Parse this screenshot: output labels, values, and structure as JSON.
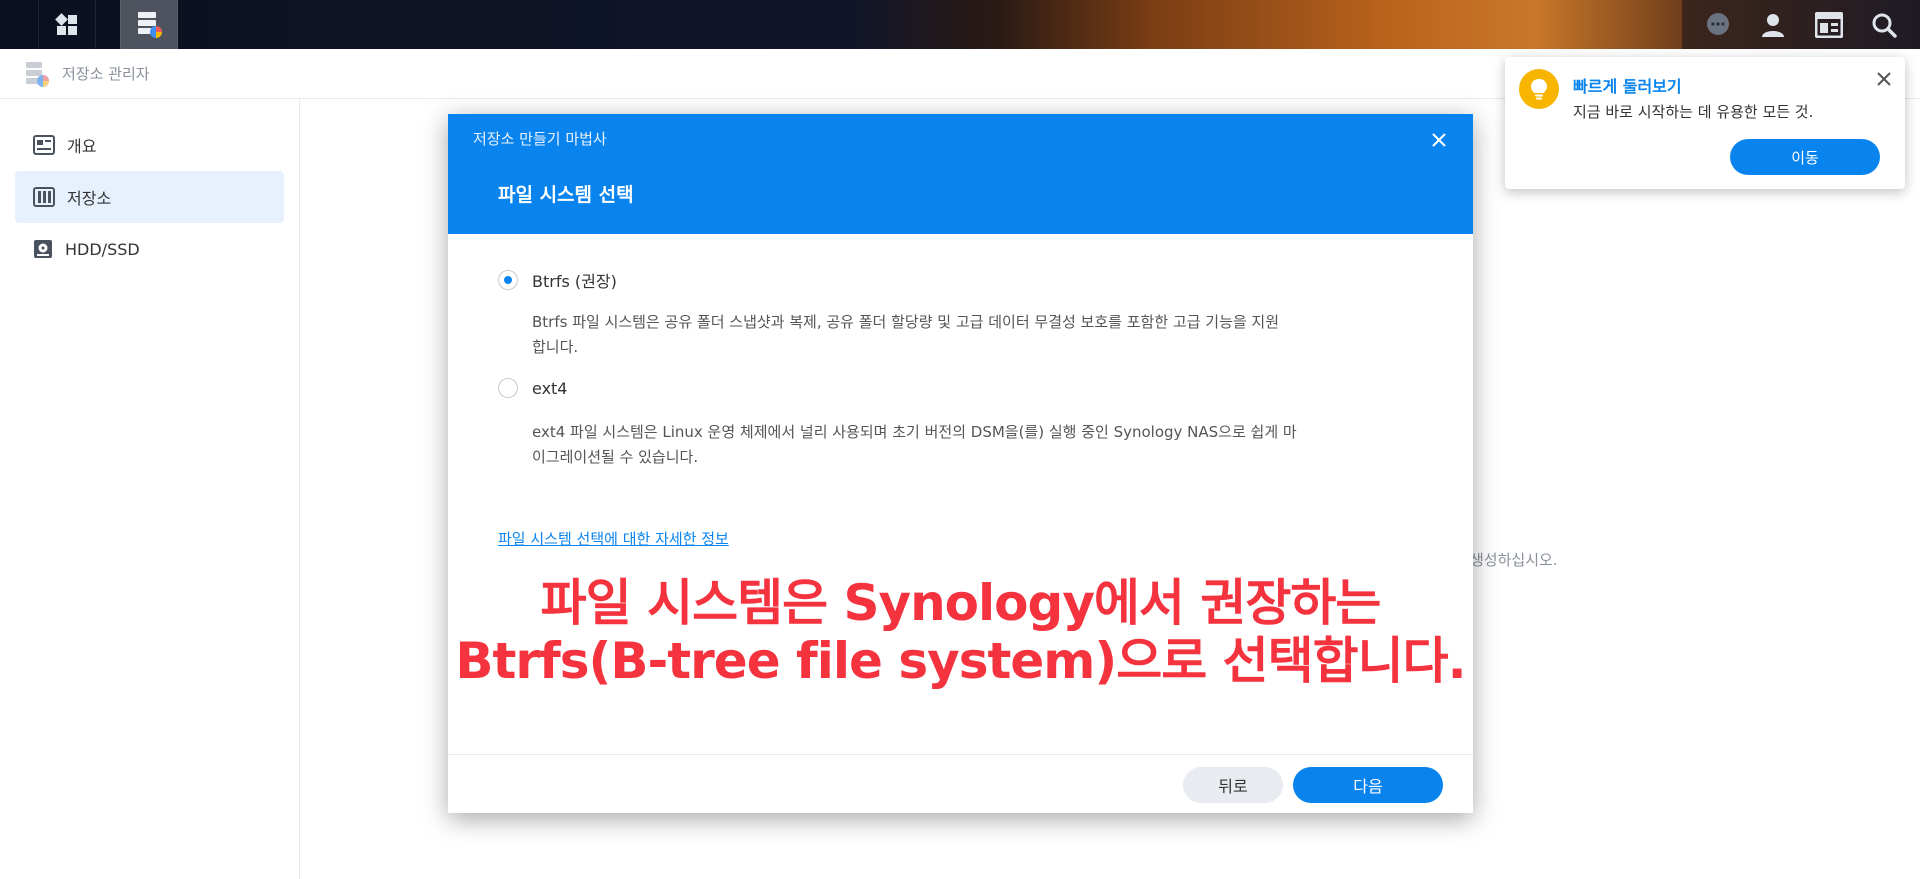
{
  "taskbar": {
    "left_icons": [
      "main-menu-icon",
      "storage-manager-app-icon"
    ],
    "right_icons": [
      "chat-icon",
      "user-icon",
      "widgets-icon",
      "search-icon"
    ]
  },
  "app": {
    "title": "저장소 관리자",
    "sidebar": {
      "items": [
        {
          "label": "개요",
          "icon": "overview-icon",
          "active": false
        },
        {
          "label": "저장소",
          "icon": "storage-icon",
          "active": true
        },
        {
          "label": "HDD/SSD",
          "icon": "hdd-icon",
          "active": false
        }
      ]
    },
    "background_text": "생성하십시오."
  },
  "modal": {
    "wizard_title": "저장소 만들기 마법사",
    "step_title": "파일 시스템 선택",
    "options": [
      {
        "label": "Btrfs (권장)",
        "checked": true,
        "desc_line1": "Btrfs 파일 시스템은 공유 폴더 스냅샷과 복제, 공유 폴더 할당량 및 고급 데이터 무결성 보호를 포함한 고급 기능을 지원",
        "desc_line2": "합니다."
      },
      {
        "label": "ext4",
        "checked": false,
        "desc_line1": "ext4 파일 시스템은 Linux 운영 체제에서 널리 사용되며 초기 버전의 DSM을(를) 실행 중인 Synology NAS으로 쉽게 마",
        "desc_line2": "이그레이션될 수 있습니다."
      }
    ],
    "more_link": "파일 시스템 선택에 대한 자세한 정보",
    "overlay_line1": "파일 시스템은 Synology에서 권장하는",
    "overlay_line2": "Btrfs(B-tree file system)으로 선택합니다.",
    "back_label": "뒤로",
    "next_label": "다음"
  },
  "notification": {
    "title": "빠르게 둘러보기",
    "text": "지금 바로 시작하는 데 유용한 모든 것.",
    "button": "이동"
  },
  "colors": {
    "accent": "#0984ee",
    "overlay_text": "#f4333f",
    "bulb": "#f7b500"
  }
}
